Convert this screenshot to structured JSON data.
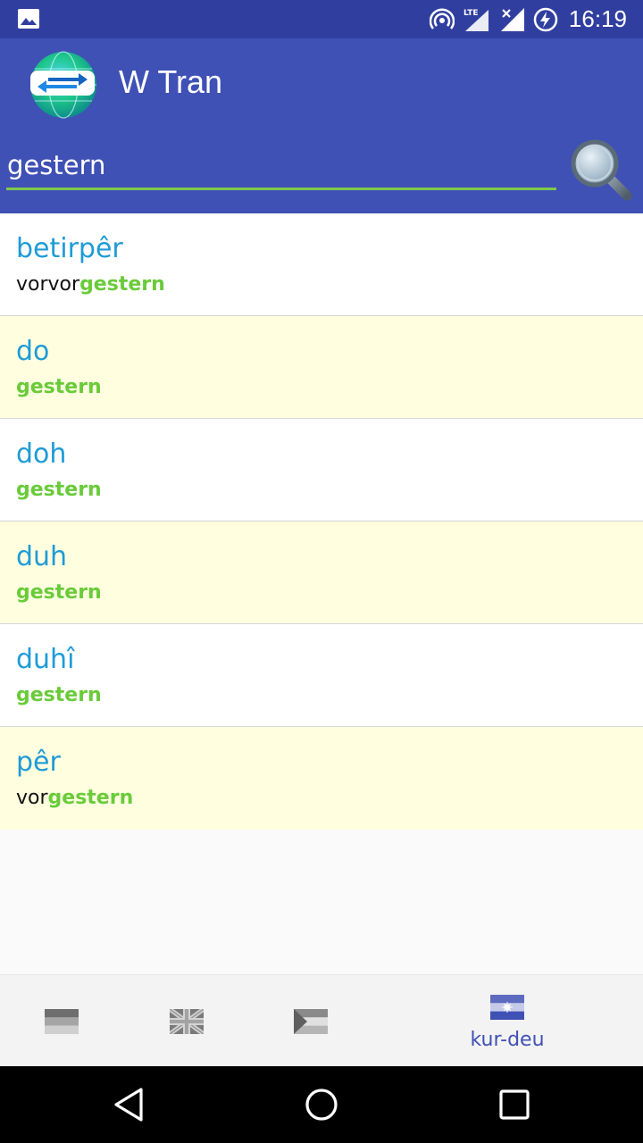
{
  "status_bar": {
    "time": "16:19",
    "network": "LTE",
    "icons": [
      "image-icon",
      "hotspot-icon",
      "lte-signal-icon",
      "signal-x-icon",
      "battery-charging-icon"
    ]
  },
  "app": {
    "title": "W Tran",
    "logo_icon": "translate-globe-icon"
  },
  "search": {
    "value": "gestern",
    "icon": "magnifier-icon"
  },
  "results": [
    {
      "term": "betirpêr",
      "prefix": "vorvor",
      "match": "gestern"
    },
    {
      "term": "do",
      "prefix": "",
      "match": "gestern"
    },
    {
      "term": "doh",
      "prefix": "",
      "match": "gestern"
    },
    {
      "term": "duh",
      "prefix": "",
      "match": "gestern"
    },
    {
      "term": "duhî",
      "prefix": "",
      "match": "gestern"
    },
    {
      "term": "pêr",
      "prefix": "vor",
      "match": "gestern"
    }
  ],
  "bottom_nav": {
    "items": [
      {
        "icon": "german-flag-icon",
        "label": ""
      },
      {
        "icon": "uk-flag-icon",
        "label": ""
      },
      {
        "icon": "kurdish-flag-icon",
        "label": ""
      },
      {
        "icon": "kur-deu-flag-icon",
        "label": "kur-deu",
        "active": true
      }
    ]
  },
  "colors": {
    "status_bar": "#303f9f",
    "app_bar": "#3f51b5",
    "term": "#1e9bd7",
    "match_highlight": "#6acb3a",
    "alt_row": "#ffffe0",
    "active_nav": "#3f51b5"
  }
}
